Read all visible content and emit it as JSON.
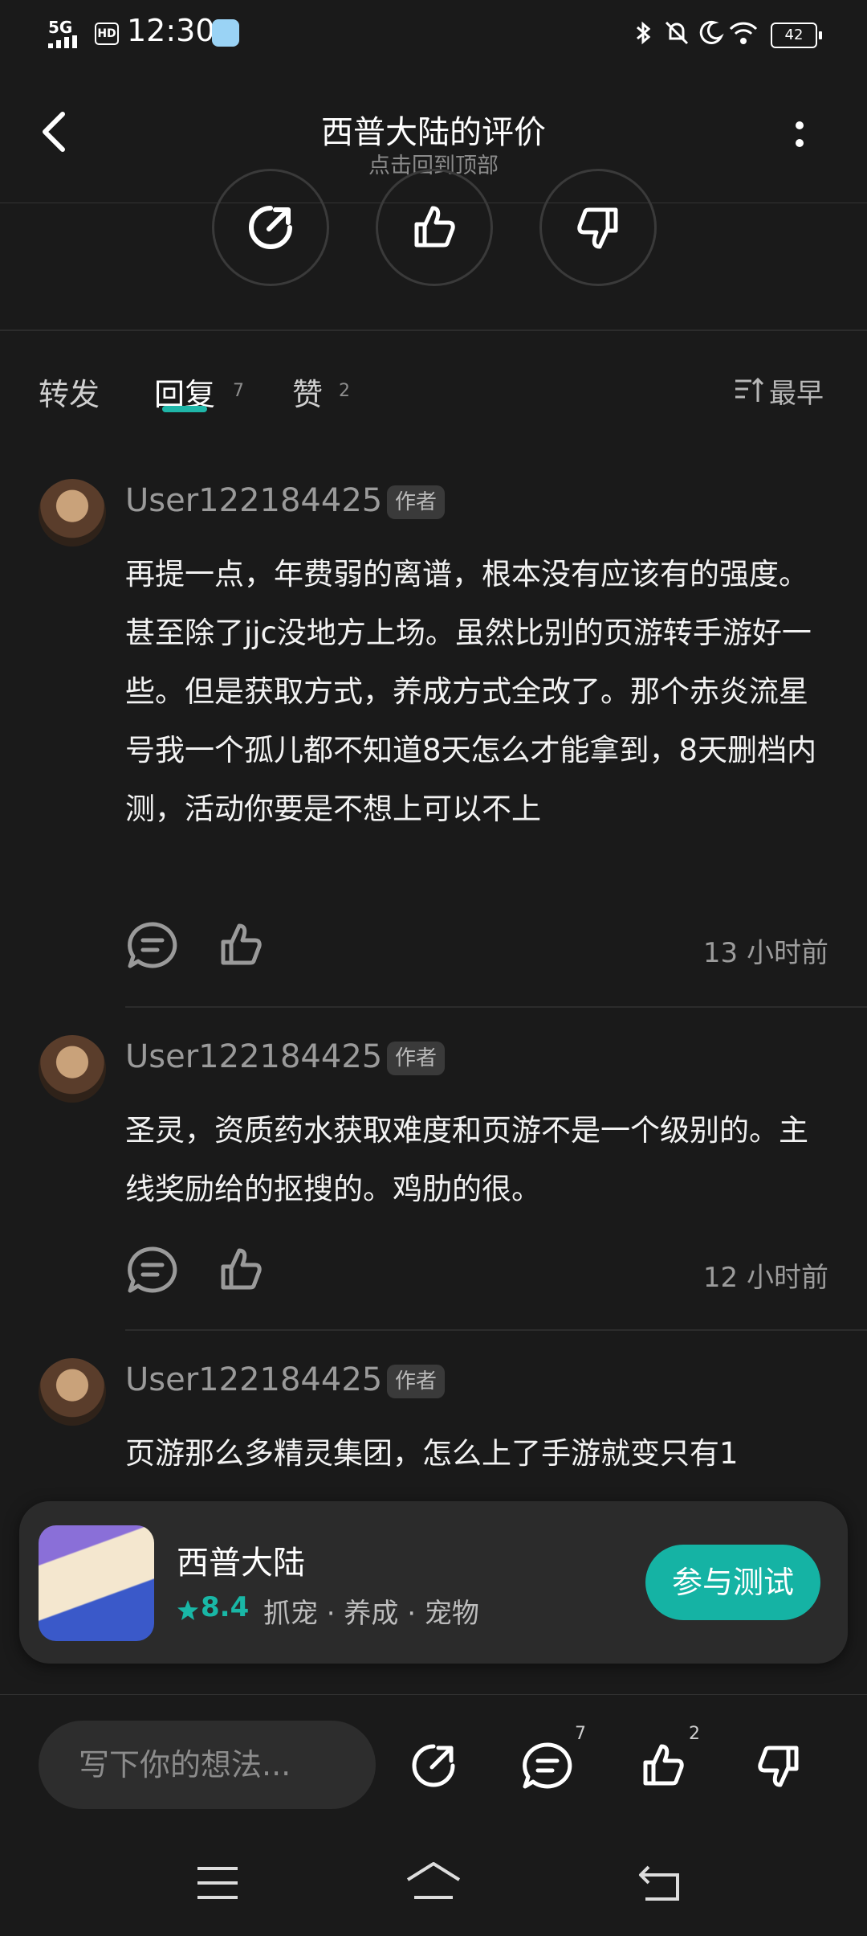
{
  "status_bar": {
    "network": "5G",
    "hd": "HD",
    "time": "12:30",
    "battery": "42"
  },
  "header": {
    "title": "西普大陆的评价",
    "subtitle": "点击回到顶部"
  },
  "tabs": [
    {
      "label": "转发",
      "count": ""
    },
    {
      "label": "回复",
      "count": "7"
    },
    {
      "label": "赞",
      "count": "2"
    }
  ],
  "sort": {
    "label": "最早"
  },
  "comments": [
    {
      "username": "User122184425",
      "badge": "作者",
      "text": "再提一点，年费弱的离谱，根本没有应该有的强度。甚至除了jjc没地方上场。虽然比别的页游转手游好一些。但是获取方式，养成方式全改了。那个赤炎流星号我一个孤儿都不知道8天怎么才能拿到，8天删档内测，活动你要是不想上可以不上",
      "time": "13 小时前"
    },
    {
      "username": "User122184425",
      "badge": "作者",
      "text": "圣灵，资质药水获取难度和页游不是一个级别的。主线奖励给的抠搜的。鸡肋的很。",
      "time": "12 小时前"
    },
    {
      "username": "User122184425",
      "badge": "作者",
      "text": "页游那么多精灵集团，怎么上了手游就变只有1",
      "time": ""
    }
  ],
  "promo": {
    "name": "西普大陆",
    "rating": "8.4",
    "tags": "抓宠 · 养成 · 宠物",
    "button": "参与测试"
  },
  "bottom_bar": {
    "placeholder": "写下你的想法...",
    "reply_count": "7",
    "like_count": "2"
  },
  "colors": {
    "accent": "#15b3a4",
    "background": "#1a1a1a"
  }
}
